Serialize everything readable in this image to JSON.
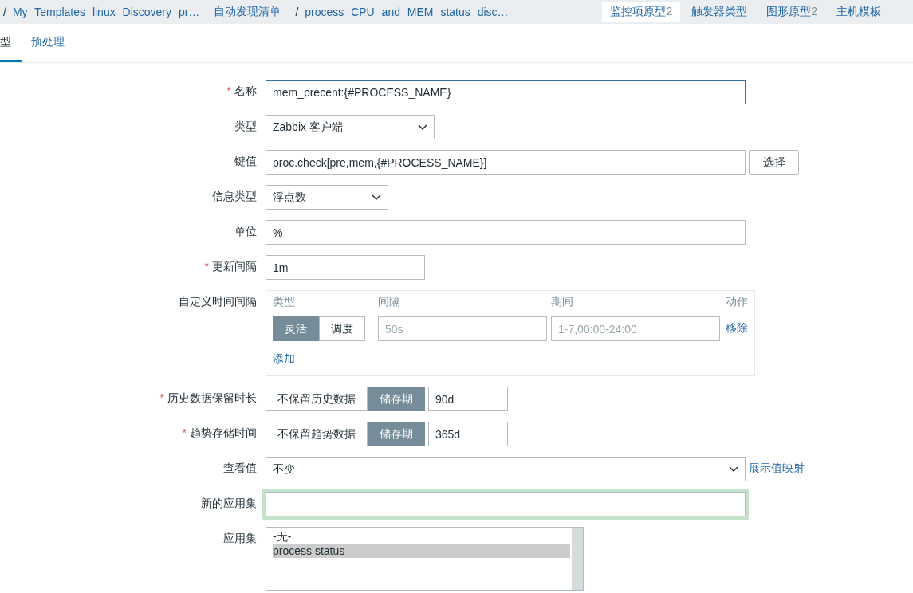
{
  "breadcrumbs": {
    "separator": "/",
    "items": [
      {
        "label": "My Templates linux Discovery pr…",
        "lead_separator": true
      },
      {
        "label": "自动发现清单",
        "lead_separator": false
      },
      {
        "label": "process CPU and MEM status disc…",
        "lead_separator": true
      }
    ]
  },
  "nav_tabs": [
    {
      "label": "监控项原型",
      "count": "2",
      "selected": true
    },
    {
      "label": "触发器类型",
      "selected": false
    },
    {
      "label": "图形原型",
      "count": "2",
      "selected": false
    },
    {
      "label": "主机模板",
      "selected": false
    }
  ],
  "sub_tabs": [
    {
      "label": "型",
      "selected": true
    },
    {
      "label": "预处理",
      "selected": false
    }
  ],
  "required_mark": "*",
  "form": [
    {
      "kind": "text",
      "label": "名称",
      "required": true,
      "value": "mem_precent:{#PROCESS_NAME}",
      "focused": true
    },
    {
      "kind": "select",
      "label": "类型",
      "required": false,
      "value": "Zabbix 客户端"
    },
    {
      "kind": "text_button",
      "label": "键值",
      "required": false,
      "value": "proc.check[pre,mem,{#PROCESS_NAME}]",
      "button": "选择"
    },
    {
      "kind": "select",
      "label": "信息类型",
      "required": false,
      "value": "浮点数"
    },
    {
      "kind": "text",
      "label": "单位",
      "required": false,
      "value": "%",
      "focused": false
    },
    {
      "kind": "text",
      "label": "更新间隔",
      "required": true,
      "value": "1m",
      "focused": false
    },
    {
      "kind": "intervals",
      "label": "自定义时间间隔",
      "required": false,
      "columns": [
        "类型",
        "间隔",
        "期间",
        "动作"
      ],
      "rows": [
        {
          "modes": [
            {
              "label": "灵活",
              "selected": true
            },
            {
              "label": "调度",
              "selected": false
            }
          ],
          "interval_placeholder": "50s",
          "period_placeholder": "1-7,00:00-24:00",
          "action": "移除"
        }
      ],
      "add": "添加"
    },
    {
      "kind": "segmented_text",
      "label": "历史数据保留时长",
      "required": true,
      "options": [
        {
          "label": "不保留历史数据",
          "selected": false
        },
        {
          "label": "储存期",
          "selected": true
        }
      ],
      "value": "90d"
    },
    {
      "kind": "segmented_text",
      "label": "趋势存储时间",
      "required": true,
      "options": [
        {
          "label": "不保留趋势数据",
          "selected": false
        },
        {
          "label": "储存期",
          "selected": true
        }
      ],
      "value": "365d"
    },
    {
      "kind": "select_link",
      "label": "查看值",
      "required": false,
      "value": "不变",
      "link": "展示值映射"
    },
    {
      "kind": "text",
      "label": "新的应用集",
      "required": false,
      "focused": false,
      "highlighted": true
    },
    {
      "kind": "listbox",
      "label": "应用集",
      "required": false,
      "items": [
        {
          "label": "-无-",
          "selected": false
        },
        {
          "label": "process status",
          "selected": true
        }
      ]
    }
  ]
}
